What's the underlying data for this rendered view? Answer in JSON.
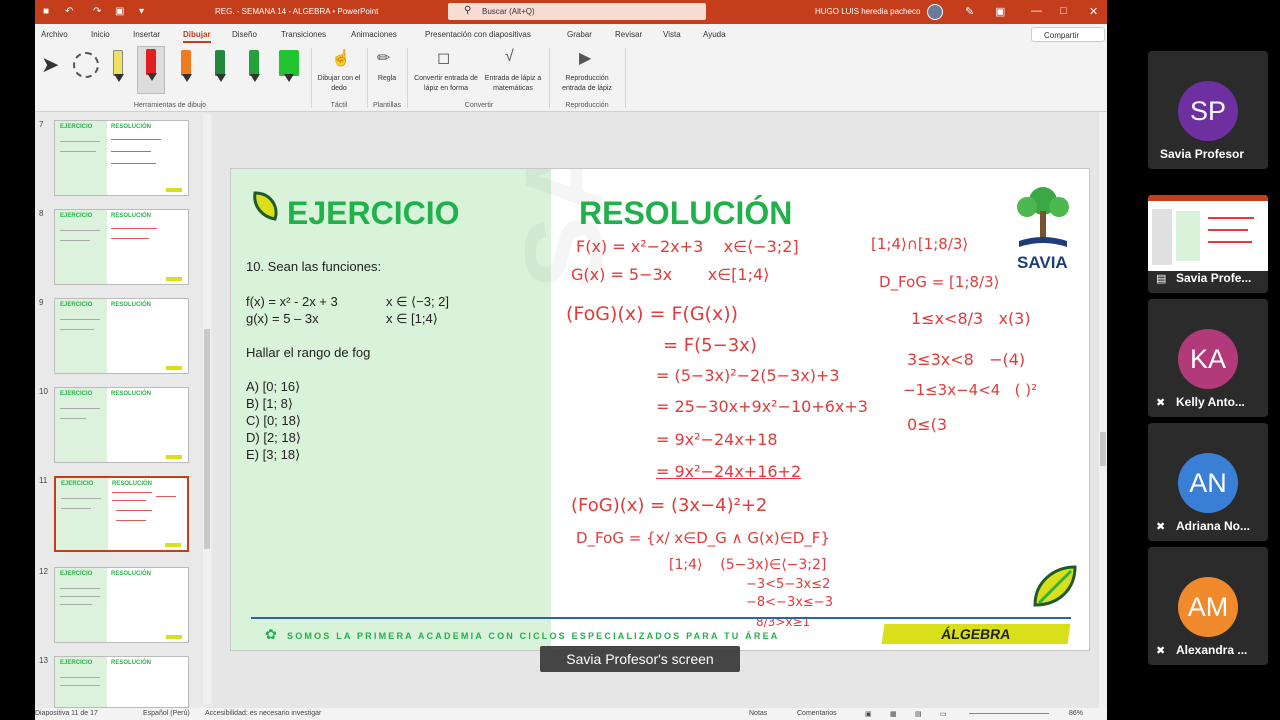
{
  "window": {
    "title": "REG. - SEMANA 14 - ALGEBRA  •  PowerPoint",
    "search_placeholder": "Buscar (Alt+Q)",
    "user": "HUGO LUIS heredia pacheco"
  },
  "menu": {
    "items": [
      "Archivo",
      "Inicio",
      "Insertar",
      "Dibujar",
      "Diseño",
      "Transiciones",
      "Animaciones",
      "Presentación con diapositivas",
      "Grabar",
      "Revisar",
      "Vista",
      "Ayuda"
    ],
    "active": "Dibujar",
    "share": "Compartir"
  },
  "ribbon": {
    "group_drawing_tools": "Herramientas de dibujo",
    "draw_finger": "Dibujar con el dedo",
    "group_touch": "Táctil",
    "ruler": "Regla",
    "group_templates": "Plantillas",
    "ink_to_shape": "Convertir entrada de lápiz en forma",
    "ink_to_math": "Entrada de lápiz a matemáticas",
    "group_convert": "Convertir",
    "ink_replay": "Reproducción entrada de lápiz",
    "group_replay": "Reproducción",
    "pen_colors": [
      "#f0e060",
      "#e02020",
      "#f07a20",
      "#1f8a3c",
      "#21a33a",
      "#22c430"
    ]
  },
  "thumbnails": [
    {
      "num": "7",
      "t1": "EJERCICIO",
      "t2": "RESOLUCIÓN"
    },
    {
      "num": "8",
      "t1": "EJERCICIO",
      "t2": "RESOLUCIÓN"
    },
    {
      "num": "9",
      "t1": "EJERCICIO",
      "t2": "RESOLUCIÓN"
    },
    {
      "num": "10",
      "t1": "EJERCICIO",
      "t2": "RESOLUCIÓN"
    },
    {
      "num": "11",
      "t1": "EJERCICIO",
      "t2": "RESOLUCIÓN"
    },
    {
      "num": "12",
      "t1": "EJERCICIO",
      "t2": "RESOLUCIÓN"
    },
    {
      "num": "13",
      "t1": "EJERCICIO",
      "t2": "RESOLUCIÓN"
    }
  ],
  "slide": {
    "left_title": "EJERCICIO",
    "right_title": "RESOLUCIÓN",
    "problem_intro": "10. Sean las funciones:",
    "f_def": "f(x) = x² - 2x + 3",
    "f_dom": "x ∈ ⟨−3; 2]",
    "g_def": "g(x) = 5 – 3x",
    "g_dom": "x ∈ [1;4⟩",
    "question": "Hallar el rango de fog",
    "options": [
      "A) [0; 16⟩",
      "B) [1; 8⟩",
      "C) [0; 18⟩",
      "D) [2; 18⟩",
      "E) [3; 18⟩"
    ],
    "brand": "SAVIA",
    "footer": "SOMOS LA PRIMERA ACADEMIA CON CICLOS ESPECIALIZADOS PARA TU ÁREA",
    "subject": "ÁLGEBRA",
    "handwriting": [
      "F(x) = x²−2x+3    x∈⟨−3;2]",
      "G(x) = 5−3x       x∈[1;4⟩",
      "(FoG)(x) = F(G(x))",
      "= F(5−3x)",
      "= (5−3x)²−2(5−3x)+3",
      "= 25−30x+9x²−10+6x+3",
      "= 9x²−24x+18",
      "= 9x²−24x+16+2",
      "(FoG)(x) = (3x−4)²+2",
      "D_FoG = {x/ x∈D_G ∧ G(x)∈D_F}",
      "[1;4⟩    (5−3x)∈⟨−3;2]",
      "−3<5−3x≤2",
      "−8<−3x≤−3",
      "8/3>x≥1",
      "[1;4⟩∩[1;8/3⟩",
      "D_FoG = [1;8/3⟩",
      "1≤x<8/3   x(3)",
      "3≤3x<8   −(4)",
      "−1≤3x−4<4   ( )²",
      "0≤(3"
    ]
  },
  "caption": "Savia Profesor's screen",
  "status": {
    "slide_info": "Diapositiva 11 de 17",
    "language": "Español (Perú)",
    "accessibility": "Accesibilidad: es necesario investigar",
    "notes": "Notas",
    "comments": "Comentarios",
    "zoom": "86%"
  },
  "participants": [
    {
      "initials": "SP",
      "name": "Savia Profesor",
      "color": "#6e2fa0",
      "muted": false,
      "sharing": false
    },
    {
      "initials": "",
      "name": "Savia Profe...",
      "color": "#2b2b2b",
      "muted": false,
      "sharing": true
    },
    {
      "initials": "KA",
      "name": "Kelly Anto...",
      "color": "#b23a7a",
      "muted": true,
      "sharing": false
    },
    {
      "initials": "AN",
      "name": "Adriana No...",
      "color": "#3a7fd6",
      "muted": true,
      "sharing": false
    },
    {
      "initials": "AM",
      "name": "Alexandra ...",
      "color": "#f08a2c",
      "muted": true,
      "sharing": false
    }
  ]
}
